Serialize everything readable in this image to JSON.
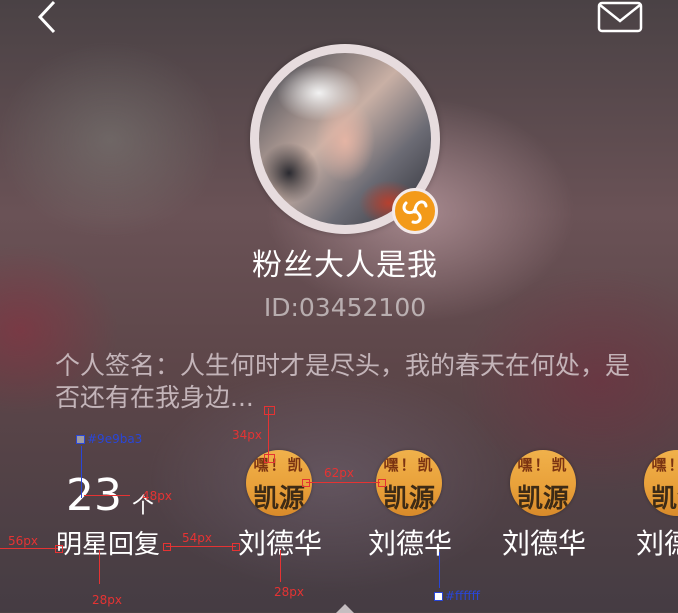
{
  "header": {
    "back_icon": "chevron-left-icon",
    "mail_icon": "envelope-icon"
  },
  "profile": {
    "nickname": "粉丝大人是我",
    "user_id": "ID:03452100",
    "signature": "个人签名：人生何时才是尽头，我的春天在何处，是否还有在我身边...",
    "badge_icon": "triskelion-icon",
    "badge_color": "#f39a19"
  },
  "stats": {
    "count": "23",
    "unit": "个",
    "label": "明星回复"
  },
  "stars": [
    {
      "name": "刘德华",
      "thumb_top": "嘿！凯",
      "thumb_bottom": "凯源系"
    },
    {
      "name": "刘德华",
      "thumb_top": "嘿！凯",
      "thumb_bottom": "凯源系"
    },
    {
      "name": "刘德华",
      "thumb_top": "嘿！凯",
      "thumb_bottom": "凯源系"
    },
    {
      "name": "刘德华",
      "thumb_top": "嘿！凯",
      "thumb_bottom": "凯源系"
    }
  ],
  "annotations": {
    "color_label_1": "#9e9ba3",
    "color_label_2": "#ffffff",
    "m_34": "34px",
    "m_48": "48px",
    "m_62": "62px",
    "m_56": "56px",
    "m_54": "54px",
    "m_28a": "28px",
    "m_28b": "28px"
  }
}
